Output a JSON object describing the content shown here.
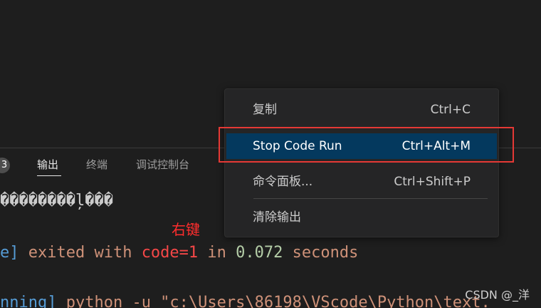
{
  "panel": {
    "badge_count": "3",
    "tabs": [
      {
        "label": "输出",
        "active": true
      },
      {
        "label": "终端",
        "active": false
      },
      {
        "label": "调试控制台",
        "active": false
      }
    ]
  },
  "output": {
    "garbled_line": "��������ļ���",
    "exit_line": {
      "bracket_part": "e]",
      "text_exited": " exited with ",
      "code": "code=1",
      "text_in": " in ",
      "duration": "0.072",
      "text_seconds": " seconds"
    },
    "running_line": {
      "bracket_part": "nning]",
      "command": " python -u \"c:\\Users\\86198\\VScode\\Python\\text."
    }
  },
  "context_menu": {
    "items": [
      {
        "label": "复制",
        "shortcut": "Ctrl+C"
      },
      {
        "label": "Stop Code Run",
        "shortcut": "Ctrl+Alt+M",
        "highlighted": true
      },
      {
        "label": "命令面板...",
        "shortcut": "Ctrl+Shift+P"
      },
      {
        "label": "清除输出",
        "shortcut": ""
      }
    ]
  },
  "annotation_text": "右键",
  "watermark_text": "CSDN @_洋",
  "colors": {
    "background": "#1e1e1e",
    "menu_background": "#252526",
    "menu_highlight": "#04395e",
    "annotation_red": "#ff2d2d",
    "box_red": "#e53935"
  }
}
